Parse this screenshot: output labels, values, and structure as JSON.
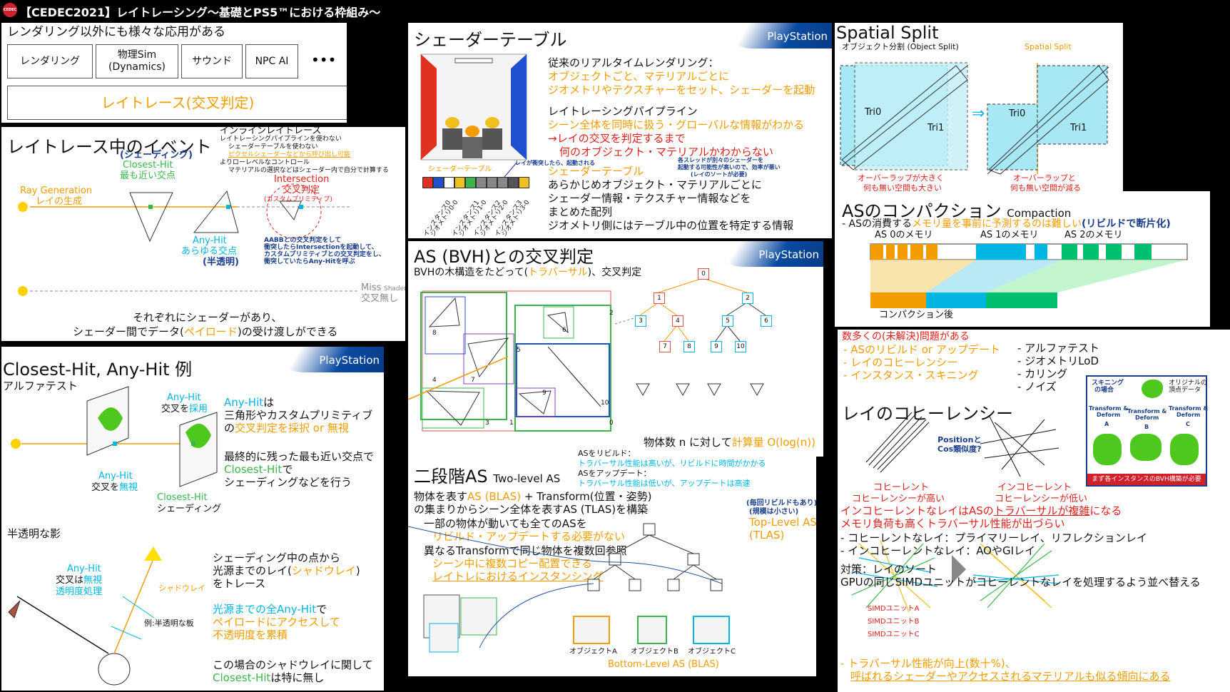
{
  "header": {
    "logo": "CEDEC",
    "title": "【CEDEC2021】レイトレーシング～基礎とPS5™における枠組み～"
  },
  "ps_logo": "PlayStation",
  "p1": {
    "title": "レンダリング以外にも様々な応用がある",
    "boxes": [
      "レンダリング",
      "物理Sim\n(Dynamics)",
      "サウンド",
      "NPC AI",
      "•••"
    ],
    "big": "レイトレース(交叉判定)"
  },
  "p2": {
    "title": "レイトレース中のイベント",
    "inline": {
      "head": "インラインレイトレース",
      "l1": "レイトレーシングパイプラインを使わない",
      "l2": "シェーダーテーブルを使わない",
      "l3": "ピクセルシェーダーなどから呼び出し可能",
      "l4": "よりローレベルなコントロール",
      "l5": "マテリアルの選択などはシェーダー内で自分で計算する"
    },
    "shading": "(シェーディング)",
    "closest": "Closest-Hit",
    "closest2": "最も近い交点",
    "raygen": "Ray Generation",
    "raygen2": "レイの生成",
    "intersection": "Intersection",
    "intersection2": "交叉判定",
    "intersection3": "(カスタムプリミティブ)",
    "anyhit": "Any-Hit",
    "anyhit2": "あらゆる交点",
    "anyhit3": "(半透明)",
    "aabb1": "AABBとの交叉判定をして",
    "aabb2": "衝突したらIntersectionを起動して、",
    "aabb3": "カスタムプリミティブとの交叉判定をし、",
    "aabb4": "衝突していたらAny-Hitを呼ぶ",
    "miss": "Miss",
    "missshader": "Shader",
    "miss2": "交叉無し",
    "foot1": "それぞれにシェーダーがあり、",
    "foot2a": "シェーダー間でデータ(",
    "foot2b": "ペイロード",
    "foot2c": ")の受け渡しができる"
  },
  "p3": {
    "title": "Closest-Hit, Any-Hit 例",
    "alpha": "アルファテスト",
    "ah_top": "Any-Hit",
    "ah_top2a": "交叉を",
    "ah_top2b": "採用",
    "ah_bot": "Any-Hit",
    "ah_bot2a": "交叉を",
    "ah_bot2b": "無視",
    "ch": "Closest-Hit",
    "ch2": "シェーディング",
    "r1a": "Any-Hit",
    "r1b": "は",
    "r2": "三角形やカスタムプリミティブ",
    "r3a": "の",
    "r3b": "交叉判定を採択 or 無視",
    "r4": "最終的に残った最も近い交点で",
    "r5a": "Closest-Hit",
    "r5b": "で",
    "r6": "シェーディングなどを行う",
    "shadow": "半透明な影",
    "ah3": "Any-Hit",
    "ah3b": "交叉は",
    "ah3c": "無視",
    "ah3d": "透明度処理",
    "shadowray": "シャドウレイ",
    "plate": "例:半透明な板",
    "s1": "シェーディング中の点から",
    "s2a": "光源までのレイ(",
    "s2b": "シャドウレイ",
    "s2c": ")",
    "s3": "をトレース",
    "s4a": "光源までの全Any-Hit",
    "s4b": "で",
    "s5": "ペイロードにアクセスして",
    "s6": "不透明度を累積",
    "s7": "この場合のシャドウレイに関して",
    "s8a": "Closest-Hit",
    "s8b": "は特に無し"
  },
  "p4": {
    "title": "シェーダーテーブル",
    "tablelabel": "シェーダーテーブル",
    "tablecolors": [
      "#e03020",
      "#2050d0",
      "#ffffff",
      "#f0c020",
      "#3ab54a",
      "#888888",
      "#888888",
      "#888888",
      "#555555",
      "#f0c020"
    ],
    "instances": [
      "インスタンス0",
      "ジオメトリ0-0",
      "インスタンス1",
      "ジオメトリ1-0",
      "インスタンス2",
      "ジオメトリ2-0",
      "インスタンス3",
      "ジオメトリ3-0"
    ],
    "raynote": "レイが衝突したら、起動される",
    "l1": "従来のリアルタイムレンダリング：",
    "l2": "オブジェクトごと、マテリアルごとに",
    "l3": "ジオメトリやテクスチャーをセット、シェーダーを起動",
    "l4": "レイトレーシングパイプライン",
    "l5": "シーン全体を同時に扱う・グローバルな情報がわかる",
    "l6": "→レイの交叉を判定するまで",
    "l7": "何のオブジェクト・マテリアルかわからない",
    "note1": "各スレッドが別々のシェーダーを",
    "note2": "起動する可能性が高いので、効率が悪い",
    "note3": "(レイのソートが必要)",
    "l8": "シェーダーテーブル",
    "l9": "あらかじめオブジェクト・マテリアルごとに",
    "l10": "シェーダー情報・テクスチャー情報などを",
    "l11": "まとめた配列",
    "l12": "ジオメトリ側にはテーブル中の位置を特定する情報"
  },
  "p5": {
    "title": "AS (BVH)との交叉判定",
    "sub_a": "BVHの木構造をたどって(",
    "sub_b": "トラバーサル",
    "sub_c": ")、交叉判定",
    "nodes": [
      "0",
      "1",
      "2",
      "3",
      "4",
      "5",
      "6",
      "7",
      "8",
      "9",
      "10"
    ],
    "foot_a": "物体数 n に対して",
    "foot_b": "計算量 O(log(n))"
  },
  "p6": {
    "title": "二段階AS",
    "title2": "Two-level AS",
    "rb1": "ASをリビルド：",
    "rb2": "トラバーサル性能は高いが、リビルドに時間がかかる",
    "ud1": "ASをアップデート：",
    "ud2": "トラバーサル性能は低いが、アップデートは高速",
    "l1a": "物体を表す",
    "l1b": "AS (BLAS)",
    "l1c": " + Transform(位置・姿勢)",
    "l2": "の集まりからシーン全体を表すAS (TLAS)を構築",
    "l3": "一部の物体が動いても全てのASを",
    "l4": "リビルド・アップデートする必要がない",
    "l5": "異なるTransformで同じ物体を複数回参照",
    "l6": "シーン中に複数コピー配置できる",
    "l7": "レイトレにおけるインスタンシング",
    "tlas_note1": "(毎回リビルドもあり)",
    "tlas_note2": "(規模は小さい)",
    "tlas": "Top-Level AS",
    "tlas2": "(TLAS)",
    "objA": "オブジェクトA",
    "objB": "オブジェクトB",
    "objC": "オブジェクトC",
    "blas": "Bottom-Level AS (BLAS)"
  },
  "p7": {
    "title": "Spatial Split",
    "sub": "オブジェクト分割 (Object Split)",
    "sslabel": "Spatial Split",
    "tri0": "Tri0",
    "tri1": "Tri1",
    "c1a": "オーバーラップが大きく",
    "c1b": "何も無い空間も大きい",
    "c2a": "オーバーラップと",
    "c2b": "何も無い空間が減る"
  },
  "p8": {
    "title": "ASのコンパクション",
    "title2": "Compaction",
    "line_a": "ASの消費する",
    "line_b": "メモリ量を事前に予測するのは難しい",
    "line_c": "(リビルドで断片化)",
    "mem0": "AS 0のメモリ",
    "mem1": "AS 1のメモリ",
    "mem2": "AS 2のメモリ",
    "after": "コンパクション後"
  },
  "p9": {
    "head": "数多くの(未解決)問題がある",
    "i1": "ASのリビルド or アップデート",
    "i2": "レイのコヒーレンシー",
    "i3": "インスタンス・スキニング",
    "j1": "アルファテスト",
    "j2": "ジオメトリLoD",
    "j3": "カリング",
    "j4": "ノイズ",
    "title": "レイのコヒーレンシー",
    "q": "Positionと\nCos類似度?",
    "coh": "コヒーレント",
    "coh2": "コヒーレンシーが高い",
    "incoh": "インコヒーレント",
    "incoh2": "コヒーレンシーが低い",
    "m1a": "インコヒーレントなレイはASの",
    "m1b": "トラバーサルが複雑",
    "m1c": "になる",
    "m2": "メモリ負荷も高くトラバーサル性能が出づらい",
    "m3": "コヒーレントなレイ：プライマリーレイ、リフレクションレイ",
    "m4": "インコヒーレントなレイ：AOやGIレイ",
    "m5": "対策：レイのソート",
    "m6": "GPUの同じSIMDユニットがコヒーレントなレイを処理するよう並べ替える",
    "simdA": "SIMDユニットA",
    "simdB": "SIMDユニットB",
    "simdC": "SIMDユニットC",
    "f1": "トラバーサル性能が向上(数十%)、",
    "f2": "呼ばれるシェーダーやアクセスされるマテリアルも似る傾向にある",
    "skin_title1": "スキニング",
    "skin_title2": "の場合",
    "orig1": "オリジナルの",
    "orig2": "頂点データ",
    "td": "Transform &\nDeform",
    "tdA": "A",
    "tdB": "B",
    "tdC": "C",
    "skin_foot": "まず各インスタンスのBVH構築が必要"
  }
}
